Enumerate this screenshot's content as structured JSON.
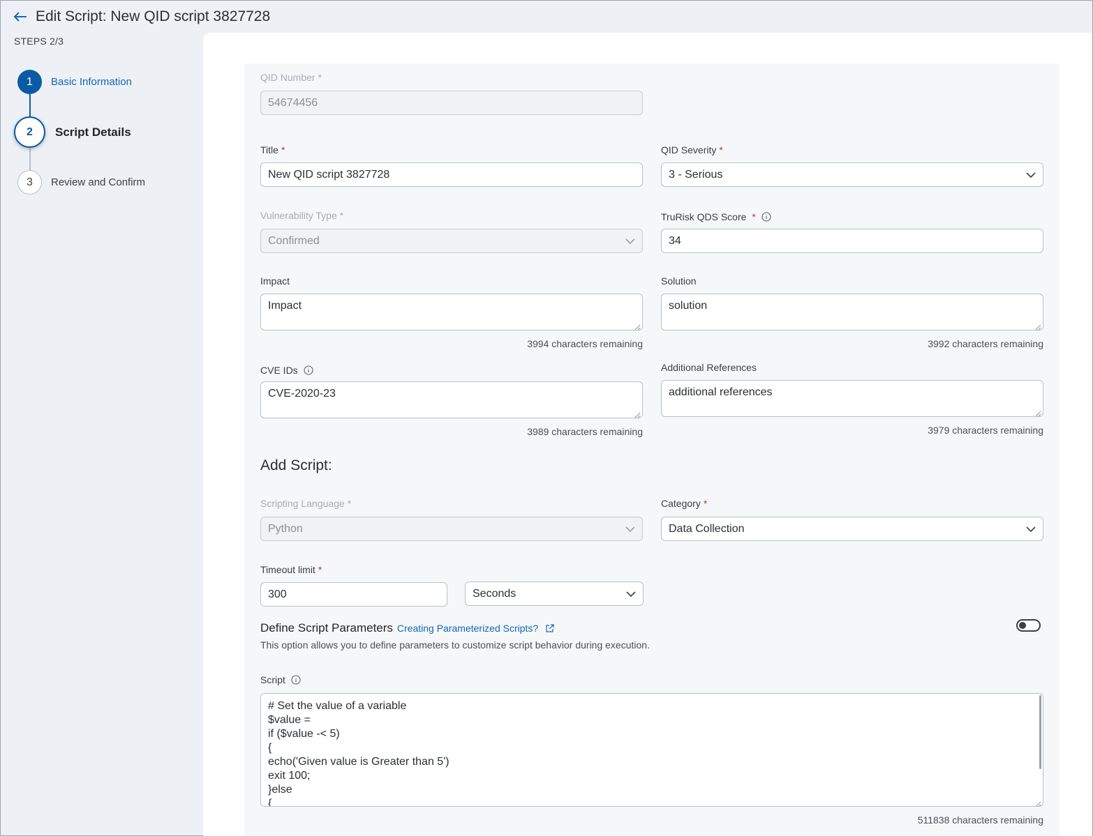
{
  "header": {
    "title": "Edit Script: New QID script 3827728"
  },
  "steps": {
    "label": "STEPS 2/3",
    "items": [
      {
        "number": "1",
        "label": "Basic Information"
      },
      {
        "number": "2",
        "label": "Script Details"
      },
      {
        "number": "3",
        "label": "Review and Confirm"
      }
    ]
  },
  "form": {
    "qid_number": {
      "label": "QID Number",
      "value": "54674456"
    },
    "title": {
      "label": "Title",
      "value": "New QID script 3827728"
    },
    "qid_severity": {
      "label": "QID Severity",
      "value": "3 - Serious"
    },
    "vulnerability_type": {
      "label": "Vulnerability Type",
      "value": "Confirmed"
    },
    "trurisk_score": {
      "label": "TruRisk QDS Score",
      "value": "34"
    },
    "impact": {
      "label": "Impact",
      "value": "Impact",
      "remaining": "3994 characters remaining"
    },
    "solution": {
      "label": "Solution",
      "value": "solution",
      "remaining": "3992 characters remaining"
    },
    "cve_ids": {
      "label": "CVE IDs",
      "value": "CVE-2020-23",
      "remaining": "3989 characters remaining"
    },
    "additional_references": {
      "label": "Additional References",
      "value": "additional references",
      "remaining": "3979 characters remaining"
    },
    "required_mark": "*"
  },
  "add_script": {
    "title": "Add Script:",
    "scripting_language": {
      "label": "Scripting Language",
      "value": "Python"
    },
    "category": {
      "label": "Category",
      "value": "Data Collection"
    },
    "timeout": {
      "label": "Timeout limit",
      "value": "300",
      "unit": "Seconds"
    },
    "params": {
      "title": "Define Script Parameters",
      "link": "Creating Parameterized Scripts?",
      "description": "This option allows you to define parameters to customize script behavior during execution.",
      "enabled": false
    },
    "script": {
      "label": "Script",
      "lines": [
        "# Set the value of a variable",
        "$value =",
        "if ($value -< 5)",
        "{",
        "echo('Given value is Greater than 5')",
        "exit 100;",
        "}else",
        "{"
      ],
      "remaining": "511838 characters remaining"
    }
  }
}
